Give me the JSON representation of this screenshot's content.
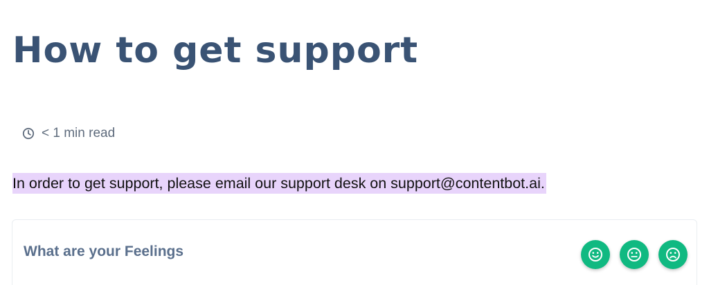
{
  "article": {
    "title": "How to get support",
    "read_time": "< 1 min read",
    "body": "In order to get support, please email our support desk on support@contentbot.ai."
  },
  "feedback": {
    "label": "What are your Feelings",
    "reactions": [
      {
        "icon": "smile-icon"
      },
      {
        "icon": "neutral-face-icon"
      },
      {
        "icon": "sad-face-icon"
      }
    ]
  },
  "colors": {
    "title": "#3a5374",
    "highlight": "#e8d4fb",
    "reaction_button": "#10b981"
  }
}
